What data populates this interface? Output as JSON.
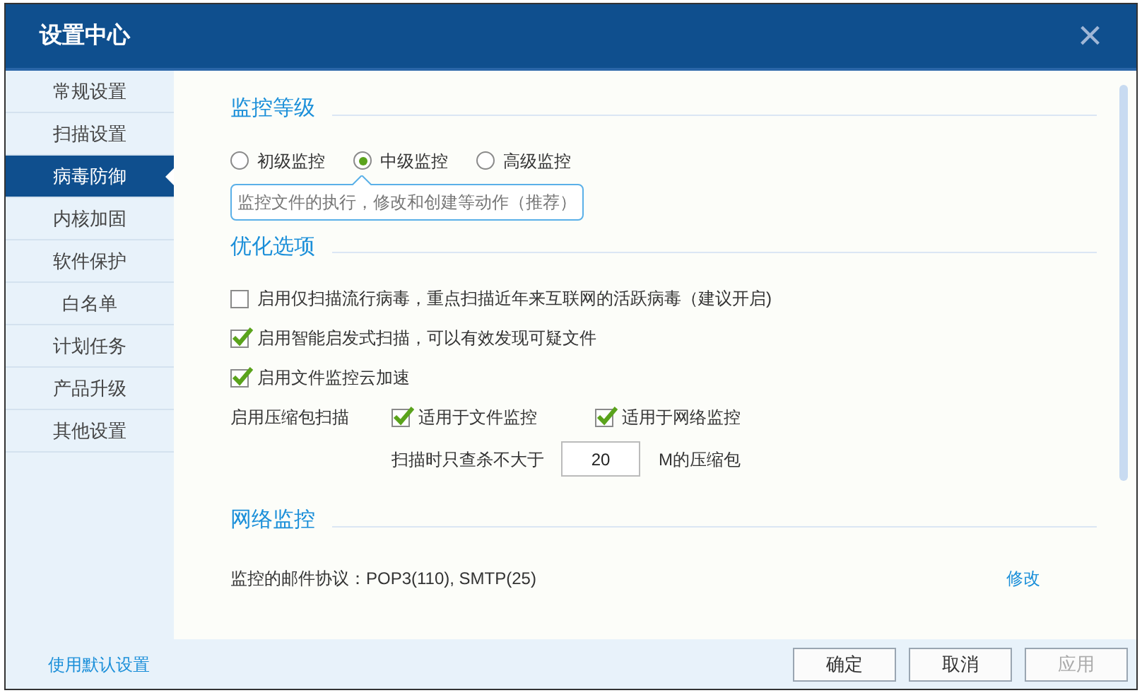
{
  "window": {
    "title": "设置中心",
    "close": "×"
  },
  "sidebar": {
    "items": [
      {
        "label": "常规设置",
        "selected": false
      },
      {
        "label": "扫描设置",
        "selected": false
      },
      {
        "label": "病毒防御",
        "selected": true
      },
      {
        "label": "内核加固",
        "selected": false
      },
      {
        "label": "软件保护",
        "selected": false
      },
      {
        "label": "白名单",
        "selected": false
      },
      {
        "label": "计划任务",
        "selected": false
      },
      {
        "label": "产品升级",
        "selected": false
      },
      {
        "label": "其他设置",
        "selected": false
      }
    ]
  },
  "monitor_level": {
    "heading": "监控等级",
    "options": [
      {
        "label": "初级监控",
        "selected": false
      },
      {
        "label": "中级监控",
        "selected": true
      },
      {
        "label": "高级监控",
        "selected": false
      }
    ],
    "tooltip": "监控文件的执行，修改和创建等动作（推荐）"
  },
  "optimize": {
    "heading": "优化选项",
    "options": [
      {
        "label": "启用仅扫描流行病毒，重点扫描近年来互联网的活跃病毒（建议开启)",
        "checked": false
      },
      {
        "label": "启用智能启发式扫描，可以有效发现可疑文件",
        "checked": true
      },
      {
        "label": "启用文件监控云加速",
        "checked": true
      }
    ],
    "archive": {
      "label": "启用压缩包扫描",
      "options": [
        {
          "label": "适用于文件监控",
          "checked": true
        },
        {
          "label": "适用于网络监控",
          "checked": true
        }
      ],
      "size_prefix": "扫描时只查杀不大于",
      "size_value": "20",
      "size_suffix": "M的压缩包"
    }
  },
  "network": {
    "heading": "网络监控",
    "protocols": "监控的邮件协议：POP3(110), SMTP(25)",
    "edit_link": "修改"
  },
  "footer": {
    "default_link": "使用默认设置",
    "buttons": [
      {
        "label": "确定",
        "disabled": false
      },
      {
        "label": "取消",
        "disabled": false
      },
      {
        "label": "应用",
        "disabled": true
      }
    ]
  }
}
